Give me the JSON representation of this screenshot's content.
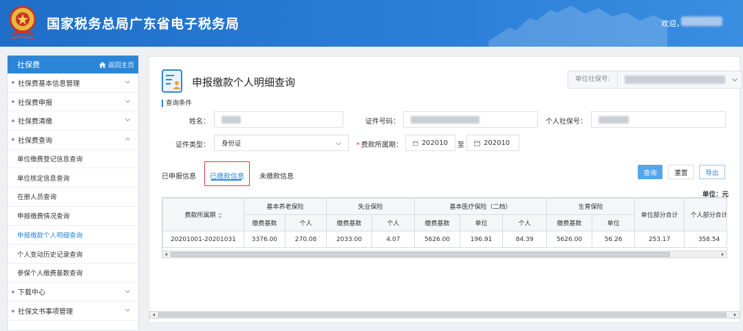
{
  "header": {
    "site_title": "国家税务总局广东省电子税务局",
    "welcome": "欢迎，",
    "brand_color": "#2b7fd8"
  },
  "sidebar": {
    "title": "社保费",
    "home_link": "返回主页",
    "menu": [
      {
        "label": "社保费基本信息管理",
        "expanded": false
      },
      {
        "label": "社保费申报",
        "expanded": false
      },
      {
        "label": "社保费清缴",
        "expanded": false
      },
      {
        "label": "社保费查询",
        "expanded": true
      }
    ],
    "sub_items": [
      {
        "label": "单位缴费登记信息查询"
      },
      {
        "label": "单位核定信息查询"
      },
      {
        "label": "在册人员查询"
      },
      {
        "label": "申报缴费情况查询"
      },
      {
        "label": "申报缴款个人明细查询",
        "active": true
      },
      {
        "label": "个人变动历史记录查询"
      },
      {
        "label": "参保个人缴费基数查询"
      }
    ],
    "menu_after": [
      {
        "label": "下载中心"
      },
      {
        "label": "社保文书事项管理"
      }
    ]
  },
  "main": {
    "page_title": "申报缴款个人明细查询",
    "unit_social_no_label": "单位社保号:",
    "section_title": "查询条件",
    "form": {
      "name_label": "姓名：",
      "id_no_label": "证件号码：",
      "personal_no_label": "个人社保号：",
      "id_type_label": "证件类型：",
      "id_type_value": "身份证",
      "period_label": "费款所属期：",
      "period_start": "202010",
      "period_sep": "至",
      "period_end": "202010"
    },
    "tabs": [
      {
        "label": "已申报信息"
      },
      {
        "label": "已缴款信息",
        "active": true
      },
      {
        "label": "未缴款信息"
      }
    ],
    "buttons": {
      "query": "查询",
      "reset": "重置",
      "export": "导出"
    },
    "unit_note": "单位：元",
    "table": {
      "period_header": "费款所属期",
      "groups": [
        {
          "name": "基本养老保险",
          "cols": [
            "缴费基数",
            "个人"
          ]
        },
        {
          "name": "失业保险",
          "cols": [
            "缴费基数",
            "个人"
          ]
        },
        {
          "name": "基本医疗保险（二档）",
          "cols": [
            "缴费基数",
            "单位",
            "个人"
          ]
        },
        {
          "name": "生育保险",
          "cols": [
            "缴费基数",
            "单位"
          ]
        }
      ],
      "unit_total_header": "单位部分合计",
      "personal_total_header": "个人部分合计",
      "rows": [
        {
          "period": "20201001-20201031",
          "cells": [
            "3376.00",
            "270.08",
            "2033.00",
            "4.07",
            "5626.00",
            "196.91",
            "84.39",
            "5626.00",
            "56.26",
            "253.17",
            "358.54"
          ]
        }
      ]
    }
  }
}
